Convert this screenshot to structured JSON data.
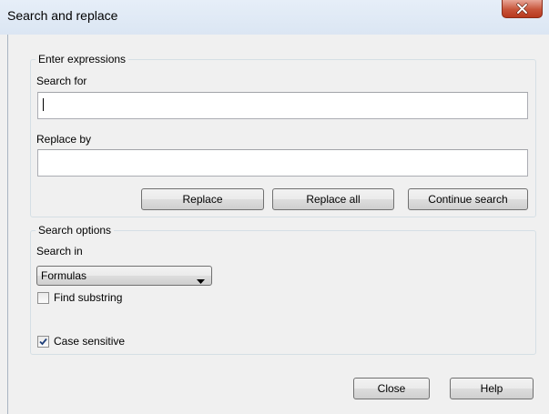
{
  "window": {
    "title": "Search and replace"
  },
  "expressions": {
    "group_label": "Enter expressions",
    "search_label": "Search for",
    "search_value": "",
    "replace_label": "Replace by",
    "replace_value": "",
    "replace_button": "Replace",
    "replace_all_button": "Replace all",
    "continue_button": "Continue search"
  },
  "options": {
    "group_label": "Search options",
    "search_in_label": "Search in",
    "search_in_value": "Formulas",
    "find_substring_label": "Find substring",
    "find_substring_checked": false,
    "case_sensitive_label": "Case sensitive",
    "case_sensitive_checked": true
  },
  "footer": {
    "close_button": "Close",
    "help_button": "Help"
  },
  "icons": {
    "close": "close-icon",
    "dropdown": "chevron-down-icon",
    "check": "checkmark-icon"
  }
}
